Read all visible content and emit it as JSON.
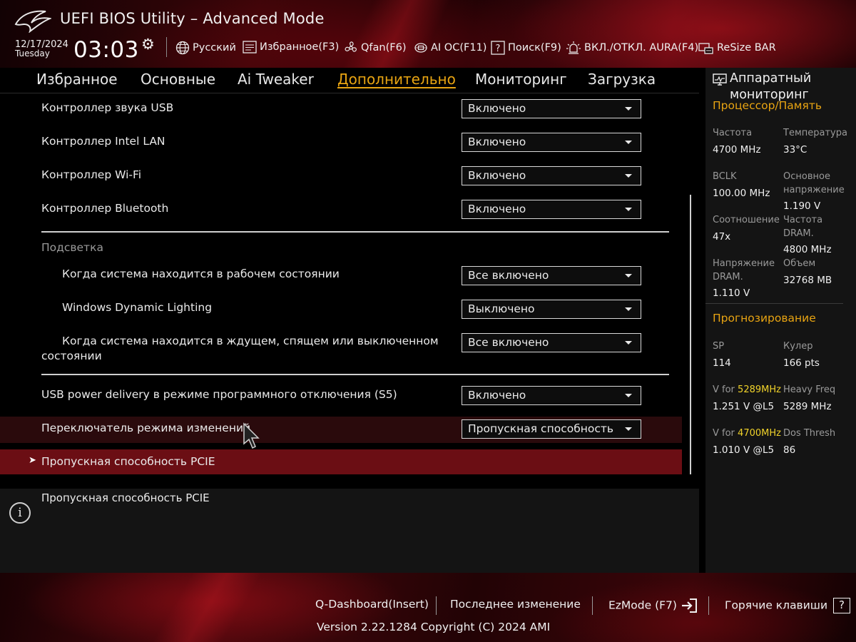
{
  "header": {
    "title": "UEFI BIOS Utility – Advanced Mode",
    "date": "12/17/2024",
    "day": "Tuesday",
    "time": "03:03",
    "tools": {
      "language": "Русский",
      "favorites": "Избранное(F3)",
      "qfan": "Qfan(F6)",
      "ai_oc": "AI OC(F11)",
      "search": "Поиск(F9)",
      "aura": "ВКЛ./ОТКЛ. AURA(F4)",
      "resize_bar": "ReSize BAR"
    }
  },
  "nav": {
    "tabs": [
      "Избранное",
      "Основные",
      "Ai Tweaker",
      "Дополнительно",
      "Мониторинг",
      "Загрузка"
    ],
    "active": "Дополнительно"
  },
  "settings": {
    "usb_audio": {
      "label": "Контроллер звука USB",
      "value": "Включено"
    },
    "intel_lan": {
      "label": "Контроллер Intel LAN",
      "value": "Включено"
    },
    "wifi": {
      "label": "Контроллер Wi-Fi",
      "value": "Включено"
    },
    "bluetooth": {
      "label": "Контроллер Bluetooth",
      "value": "Включено"
    },
    "lighting_section": "Подсветка",
    "working_state": {
      "label": "Когда система находится в рабочем состоянии",
      "value": "Все включено"
    },
    "dynamic_lighting": {
      "label": "Windows Dynamic Lighting",
      "value": "Выключено"
    },
    "sleep_state": {
      "label_line1": "Когда система находится в ждущем, спящем или выключенном",
      "label_line2": "состоянии",
      "value": "Все включено"
    },
    "usb_power_s5": {
      "label": "USB power delivery в режиме программного отключения (S5)",
      "value": "Включено"
    },
    "mode_switch": {
      "label": "Переключатель режима изменений",
      "value": "Пропускная способность PCIE"
    },
    "pcie_bandwidth": {
      "label": "Пропускная способность PCIE"
    }
  },
  "help": {
    "text": "Пропускная способность PCIE"
  },
  "monitor": {
    "title": "Аппаратный мониторинг",
    "cpu_mem": {
      "title": "Процессор/Память",
      "freq_label": "Частота",
      "freq": "4700 MHz",
      "temp_label": "Температура",
      "temp": "33°C",
      "bclk_label": "BCLK",
      "bclk": "100.00 MHz",
      "core_v_label_1": "Основное",
      "core_v_label_2": "напряжение",
      "core_v": "1.190 V",
      "ratio_label": "Соотношение",
      "ratio": "47x",
      "dram_freq_label_1": "Частота",
      "dram_freq_label_2": "DRAM.",
      "dram_freq": "4800 MHz",
      "dram_v_label_1": "Напряжение",
      "dram_v_label_2": "DRAM.",
      "dram_v": "1.110 V",
      "capacity_label": "Объем",
      "capacity": "32768 MB"
    },
    "prediction": {
      "title": "Прогнозирование",
      "sp_label": "SP",
      "sp": "114",
      "cooler_label": "Кулер",
      "cooler": "166 pts",
      "v_for_prefix": "V for ",
      "v1_freq": "5289MHz",
      "v1": "1.251 V @L5",
      "heavy_label": "Heavy Freq",
      "heavy": "5289 MHz",
      "v2_freq": "4700MHz",
      "v2": "1.010 V @L5",
      "dos_label": "Dos Thresh",
      "dos": "86"
    }
  },
  "footer": {
    "qdashboard": "Q-Dashboard(Insert)",
    "last_change": "Последнее изменение",
    "ezmode": "EzMode (F7)",
    "hotkeys": "Горячие клавиши",
    "hotkeys_icon": "?",
    "version": "Version 2.22.1284 Copyright (C) 2024 AMI"
  },
  "colors": {
    "accent": "#e8a412",
    "highlight_value": "#f0d22a",
    "selected_row": "#6b0e14"
  }
}
